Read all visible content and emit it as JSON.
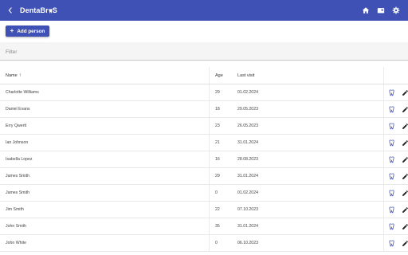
{
  "appbar": {
    "title_pre": "DentaBr",
    "title_post": "S",
    "bg_color": "#3f51b5"
  },
  "icons": {
    "back": "arrow-back-icon",
    "home": "home-icon",
    "cards": "badge-icon",
    "settings": "gear-icon",
    "tooth": "tooth-icon",
    "edit": "pencil-icon"
  },
  "toolbar": {
    "add_label": "Add person",
    "add_icon": "+"
  },
  "filter": {
    "placeholder": "Filter"
  },
  "table": {
    "headers": {
      "name": "Name",
      "sort": "↑",
      "age": "Age",
      "last_visit": "Last visit"
    },
    "rows": [
      {
        "name": "Charlotte Williams",
        "age": "29",
        "last_visit": "01.02.2024"
      },
      {
        "name": "Daniel Evans",
        "age": "18",
        "last_visit": "29.05.2023"
      },
      {
        "name": "Erry Qwertt",
        "age": "23",
        "last_visit": "26.05.2023"
      },
      {
        "name": "Ian Johnson",
        "age": "21",
        "last_visit": "31.01.2024"
      },
      {
        "name": "Isabella Lopez",
        "age": "16",
        "last_visit": "28.08.2023"
      },
      {
        "name": "James Smith",
        "age": "29",
        "last_visit": "31.01.2024"
      },
      {
        "name": "James Smith",
        "age": "0",
        "last_visit": "01.02.2024"
      },
      {
        "name": "Jim Smith",
        "age": "22",
        "last_visit": "07.10.2023"
      },
      {
        "name": "John Smith",
        "age": "35",
        "last_visit": "31.01.2024"
      },
      {
        "name": "John White",
        "age": "0",
        "last_visit": "06.10.2023"
      }
    ]
  }
}
